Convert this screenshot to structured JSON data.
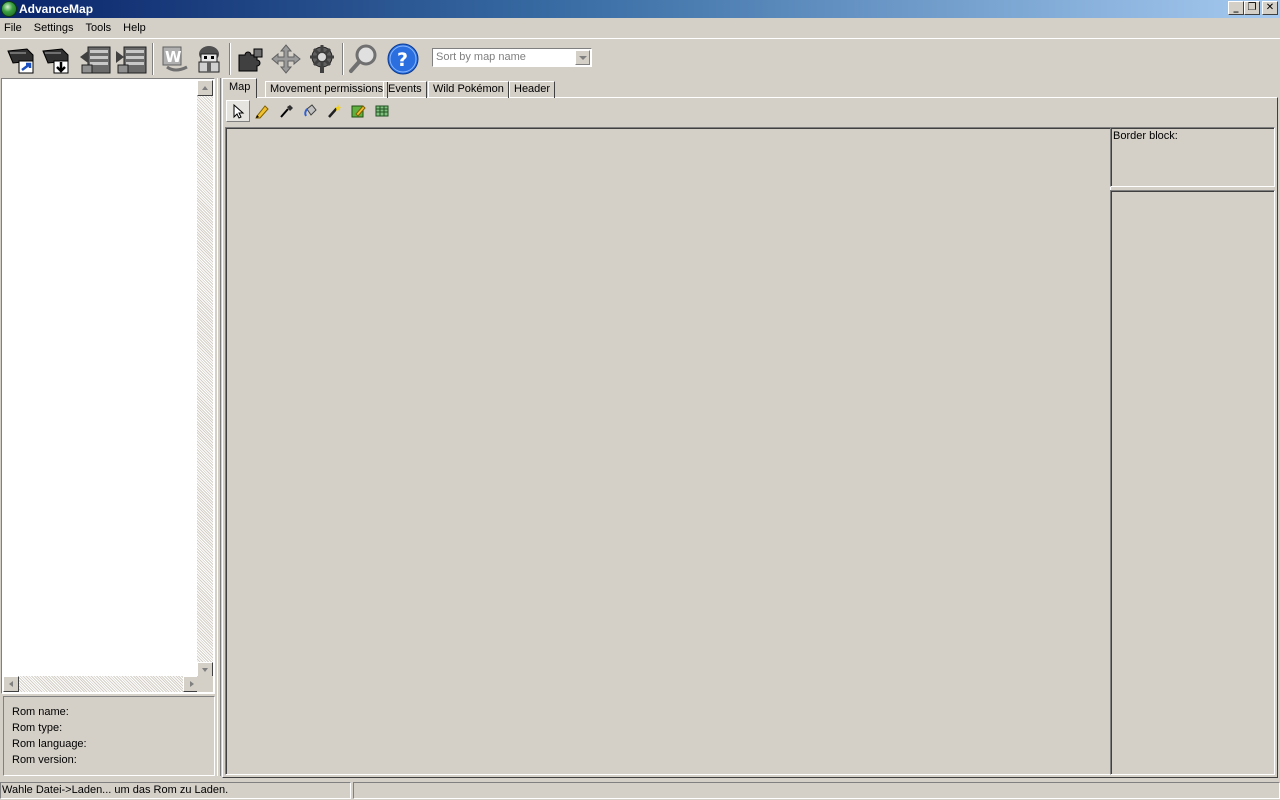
{
  "window": {
    "title": "AdvanceMap",
    "minimize": "_",
    "restore": "❐",
    "close": "✕"
  },
  "menu": [
    "File",
    "Settings",
    "Tools",
    "Help"
  ],
  "toolbar": {
    "buttons": [
      {
        "name": "open-rom-icon"
      },
      {
        "name": "save-rom-icon"
      },
      {
        "name": "import-map-icon"
      },
      {
        "name": "export-map-icon"
      },
      {
        "name": "world-map-icon"
      },
      {
        "name": "sprite-editor-icon"
      },
      {
        "name": "puzzle-icon"
      },
      {
        "name": "move-arrows-icon"
      },
      {
        "name": "gear-icon"
      },
      {
        "name": "magnifier-icon"
      },
      {
        "name": "help-icon"
      }
    ],
    "sort_value": "Sort by map name"
  },
  "rom_info": {
    "name_label": "Rom name:",
    "type_label": "Rom type:",
    "language_label": "Rom language:",
    "version_label": "Rom version:"
  },
  "tabs": [
    "Map",
    "Movement permissions",
    "Events",
    "Wild Pokémon",
    "Header"
  ],
  "map_tools": [
    {
      "name": "pointer-tool-icon"
    },
    {
      "name": "pencil-tool-icon"
    },
    {
      "name": "eyedropper-tool-icon"
    },
    {
      "name": "fill-tool-icon"
    },
    {
      "name": "magic-wand-tool-icon"
    },
    {
      "name": "edit-block-tool-icon"
    },
    {
      "name": "grid-tool-icon"
    }
  ],
  "border_block_label": "Border block:",
  "status": {
    "message": "Wahle Datei->Laden... um das Rom zu Laden.",
    "secondary": ""
  },
  "colors": {
    "face": "#d4d0c8",
    "title_start": "#0a246a",
    "title_end": "#a6caf0",
    "help_blue": "#2a6ee0"
  }
}
